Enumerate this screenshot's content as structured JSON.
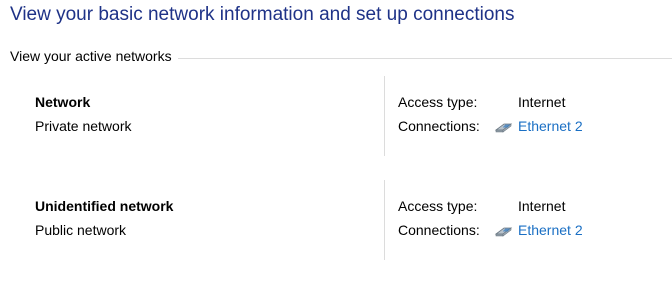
{
  "page": {
    "title": "View your basic network information and set up connections",
    "section_label": "View your active networks"
  },
  "networks": [
    {
      "name": "Network",
      "category": "Private network",
      "access_label": "Access type:",
      "access_value": "Internet",
      "connections_label": "Connections:",
      "connection_name": "Ethernet 2",
      "connection_icon": "ethernet-icon"
    },
    {
      "name": "Unidentified network",
      "category": "Public network",
      "access_label": "Access type:",
      "access_value": "Internet",
      "connections_label": "Connections:",
      "connection_name": "Ethernet 2",
      "connection_icon": "ethernet-icon"
    }
  ],
  "colors": {
    "title": "#1e3287",
    "link": "#1a6fc4",
    "divider": "#dcdcdc"
  }
}
